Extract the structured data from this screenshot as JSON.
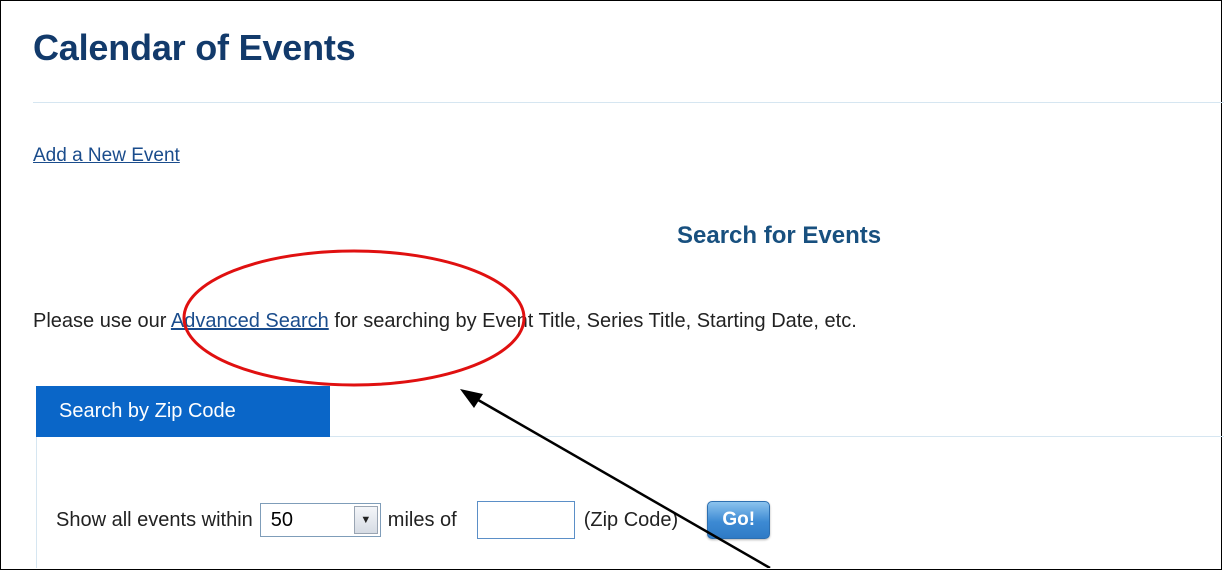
{
  "page": {
    "title": "Calendar of Events",
    "add_event_link": "Add a New Event"
  },
  "search": {
    "heading": "Search for Events",
    "intro_before": "Please use our ",
    "advanced_link": "Advanced Search",
    "intro_after": " for searching by Event Title, Series Title, Starting Date, etc."
  },
  "zip_tab": {
    "label": "Search by Zip Code"
  },
  "zip_form": {
    "prefix": "Show all events within",
    "miles_selected": "50",
    "miles_label": "miles of",
    "zip_value": "",
    "zip_label": "(Zip Code)",
    "go_label": "Go!"
  },
  "annotation": {
    "circle_color": "#e01010",
    "arrow_color": "#000000"
  }
}
